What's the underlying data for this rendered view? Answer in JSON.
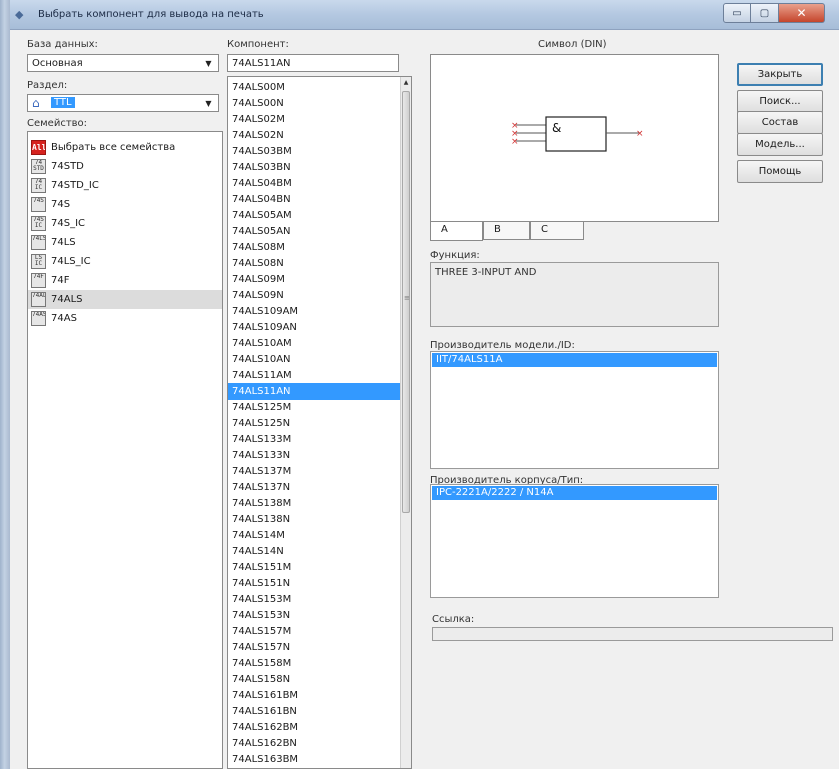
{
  "window": {
    "title": "Выбрать компонент для вывода на печать",
    "buttons": {
      "minimize": "▭",
      "maximize": "▢",
      "close": "✕"
    }
  },
  "database": {
    "label": "База данных:",
    "value": "Основная"
  },
  "section": {
    "label": "Раздел:",
    "value": "TTL"
  },
  "family": {
    "label": "Семейство:",
    "items": [
      {
        "icon": "All",
        "label": "Выбрать все семейства"
      },
      {
        "icon": "74 STD",
        "label": "74STD"
      },
      {
        "icon": "74 IC",
        "label": "74STD_IC"
      },
      {
        "icon": "74S",
        "label": "74S"
      },
      {
        "icon": "74S IC",
        "label": "74S_IC"
      },
      {
        "icon": "74LS",
        "label": "74LS"
      },
      {
        "icon": "LS IC",
        "label": "74LS_IC"
      },
      {
        "icon": "74F",
        "label": "74F"
      },
      {
        "icon": "74ALS",
        "label": "74ALS"
      },
      {
        "icon": "74AS",
        "label": "74AS"
      }
    ],
    "selected": "74ALS"
  },
  "component": {
    "label": "Компонент:",
    "value": "74ALS11AN",
    "items": [
      "74ALS00M",
      "74ALS00N",
      "74ALS02M",
      "74ALS02N",
      "74ALS03BM",
      "74ALS03BN",
      "74ALS04BM",
      "74ALS04BN",
      "74ALS05AM",
      "74ALS05AN",
      "74ALS08M",
      "74ALS08N",
      "74ALS09M",
      "74ALS09N",
      "74ALS109AM",
      "74ALS109AN",
      "74ALS10AM",
      "74ALS10AN",
      "74ALS11AM",
      "74ALS11AN",
      "74ALS125M",
      "74ALS125N",
      "74ALS133M",
      "74ALS133N",
      "74ALS137M",
      "74ALS137N",
      "74ALS138M",
      "74ALS138N",
      "74ALS14M",
      "74ALS14N",
      "74ALS151M",
      "74ALS151N",
      "74ALS153M",
      "74ALS153N",
      "74ALS157M",
      "74ALS157N",
      "74ALS158M",
      "74ALS158N",
      "74ALS161BM",
      "74ALS161BN",
      "74ALS162BM",
      "74ALS162BN",
      "74ALS163BM"
    ],
    "selected": "74ALS11AN"
  },
  "symbol": {
    "label": "Символ (DIN)",
    "gate_text": "&",
    "tabs": [
      "A",
      "B",
      "C"
    ],
    "active_tab": "A"
  },
  "function": {
    "label": "Функция:",
    "value": "THREE 3-INPUT AND"
  },
  "model_maker": {
    "label": "Производитель модели./ID:",
    "selected": "IIT/74ALS11A"
  },
  "package_maker": {
    "label": "Производитель корпуса/Тип:",
    "selected": "IPC-2221A/2222 / N14A"
  },
  "link": {
    "label": "Ссылка:",
    "value": ""
  },
  "buttons": {
    "close": "Закрыть",
    "search": "Поиск...",
    "composition": "Состав",
    "model": "Модель...",
    "help": "Помощь"
  },
  "colors": {
    "selection": "#3399ff",
    "gate_pins": "#d03030",
    "title_bar": "#b4c8e1"
  }
}
